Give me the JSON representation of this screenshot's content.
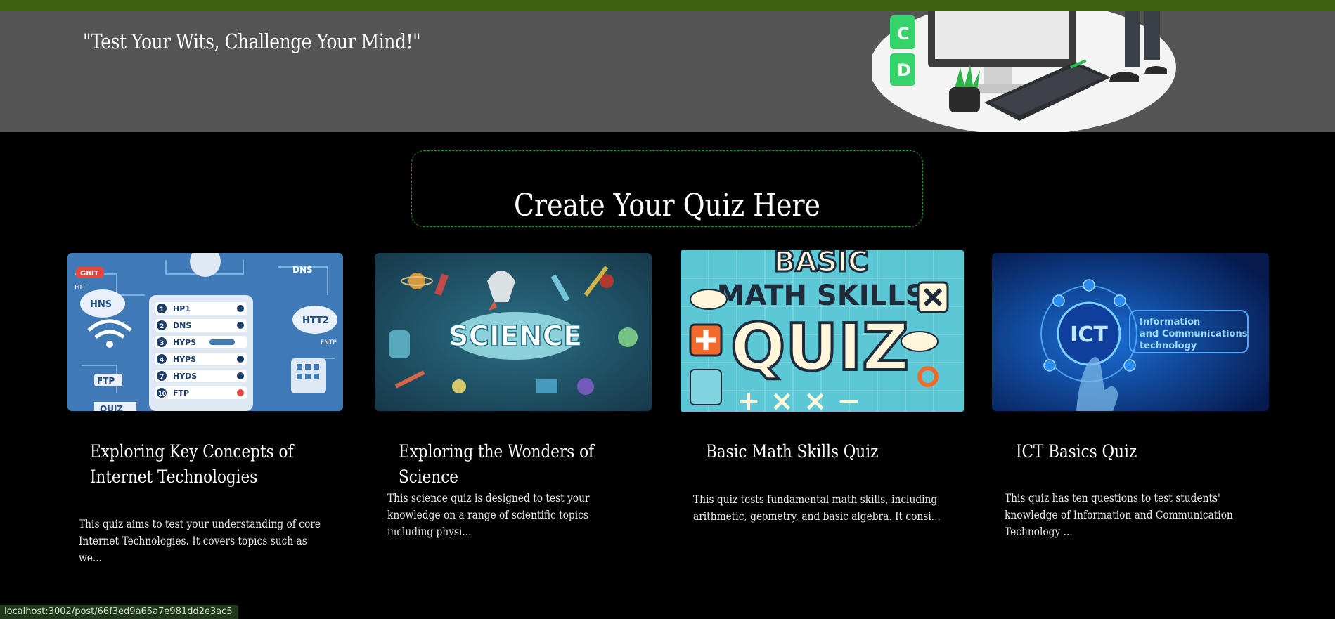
{
  "hero": {
    "tagline": "\"Test Your Wits, Challenge Your Mind!\""
  },
  "create": {
    "label": "Create Your Quiz Here"
  },
  "quizzes": [
    {
      "title": "Exploring Key Concepts of Internet Technologies",
      "description": "This quiz aims to test your understanding of core Internet Technologies. It covers topics such as we...",
      "image_text": [
        "GBIT",
        "HIT",
        "DNS",
        "HNS",
        "HTT2",
        "FNTP",
        "FTP",
        "QUIZ"
      ],
      "list_rows": [
        "HP1",
        "DNS",
        "HYPS",
        "HYPS",
        "HYDS",
        "FTP"
      ],
      "list_nums": [
        "1",
        "2",
        "3",
        "4",
        "7",
        "10"
      ]
    },
    {
      "title": "Exploring the Wonders of Science",
      "description": "This science quiz is designed to test your knowledge on a range of scientific topics including physi...",
      "image_text": [
        "SCIENCE"
      ]
    },
    {
      "title": "Basic Math Skills Quiz",
      "description": "This quiz tests fundamental math skills, including arithmetic, geometry, and basic algebra. It consi...",
      "image_text": [
        "BASIC",
        "MATH SKILLS",
        "QUIZ"
      ]
    },
    {
      "title": "ICT Basics Quiz",
      "description": "This quiz has ten questions to test students' knowledge of Information and Communication Technology ...",
      "image_text": [
        "ICT",
        "Information",
        "and Communications",
        "technology"
      ]
    }
  ],
  "status_bar": {
    "url": "localhost:3002/post/66f3ed9a65a7e981dd2e3ac5"
  },
  "colors": {
    "top_bar": "#3f6112",
    "hero_bg": "#555555",
    "page_bg": "#000000",
    "create_border": "#13a61c",
    "status_bg": "#20381a"
  }
}
